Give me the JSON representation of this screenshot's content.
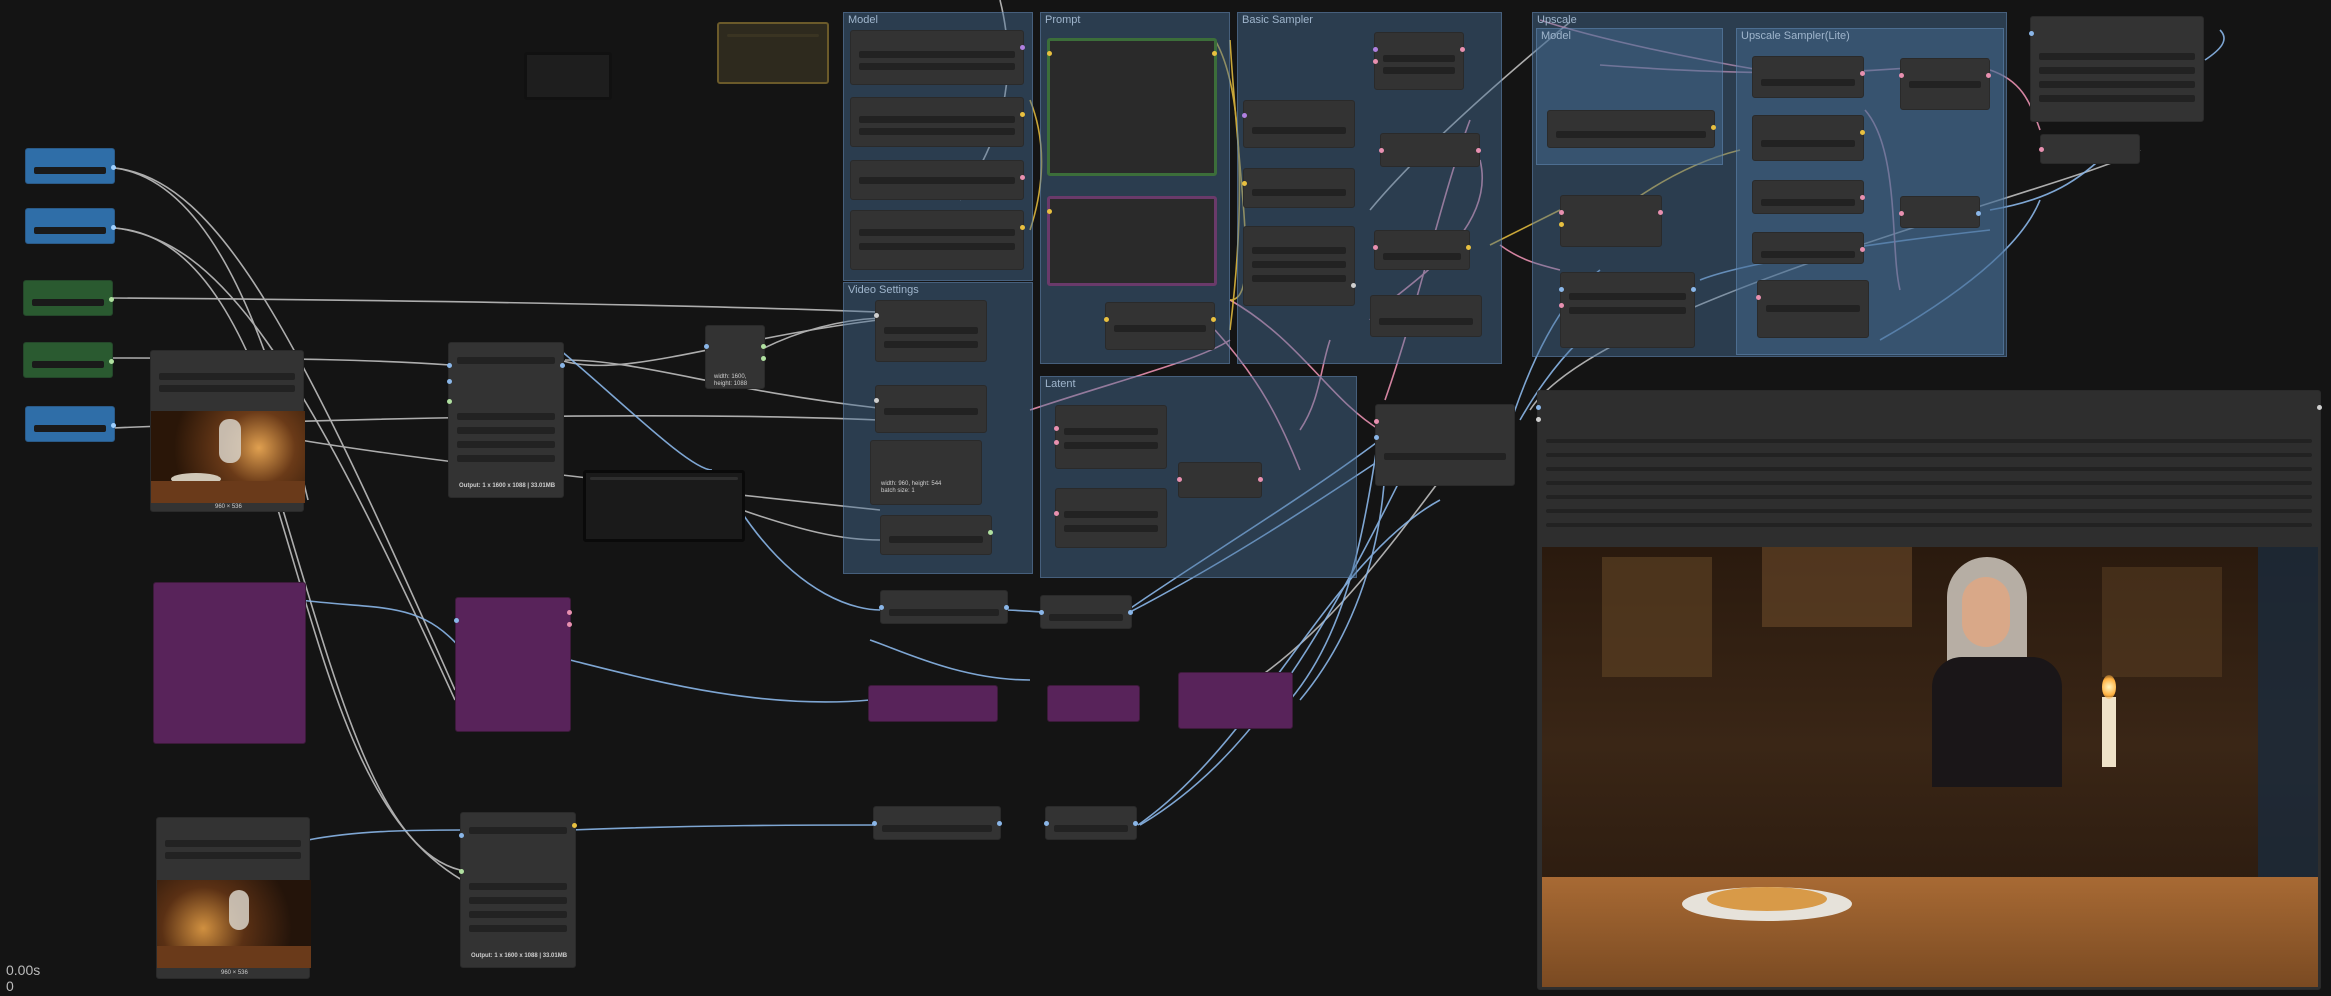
{
  "groups": {
    "model": "Model",
    "prompt": "Prompt",
    "basic_sampler": "Basic Sampler",
    "upscale": "Upscale",
    "upscale_model": "Model",
    "upscale_sampler": "Upscale Sampler(Lite)",
    "video_settings": "Video Settings",
    "latent": "Latent"
  },
  "labels": {
    "resize_info": "width: 1600, height: 1088",
    "latent_info": "width: 960, height: 544\nbatch size: 1",
    "output_1": "Output: 1 x 1600 x 1088 | 33.01MB",
    "output_2": "Output: 1 x 1600 x 1088 | 33.01MB",
    "image_caption_1": "960 × 536",
    "image_caption_2": "960 × 536"
  },
  "status": {
    "time": "0.00s",
    "queue": "0"
  },
  "colors": {
    "background": "#141414",
    "group": "#3f607f",
    "node": "#333333",
    "primitive_blue": "#2f6ea8",
    "primitive_green": "#2a5a30",
    "purple_node": "#52204f",
    "wire_blue": "#8ab6e8",
    "wire_white": "#c8c8c8",
    "wire_pink": "#e890b0",
    "wire_yellow": "#e8c040"
  }
}
